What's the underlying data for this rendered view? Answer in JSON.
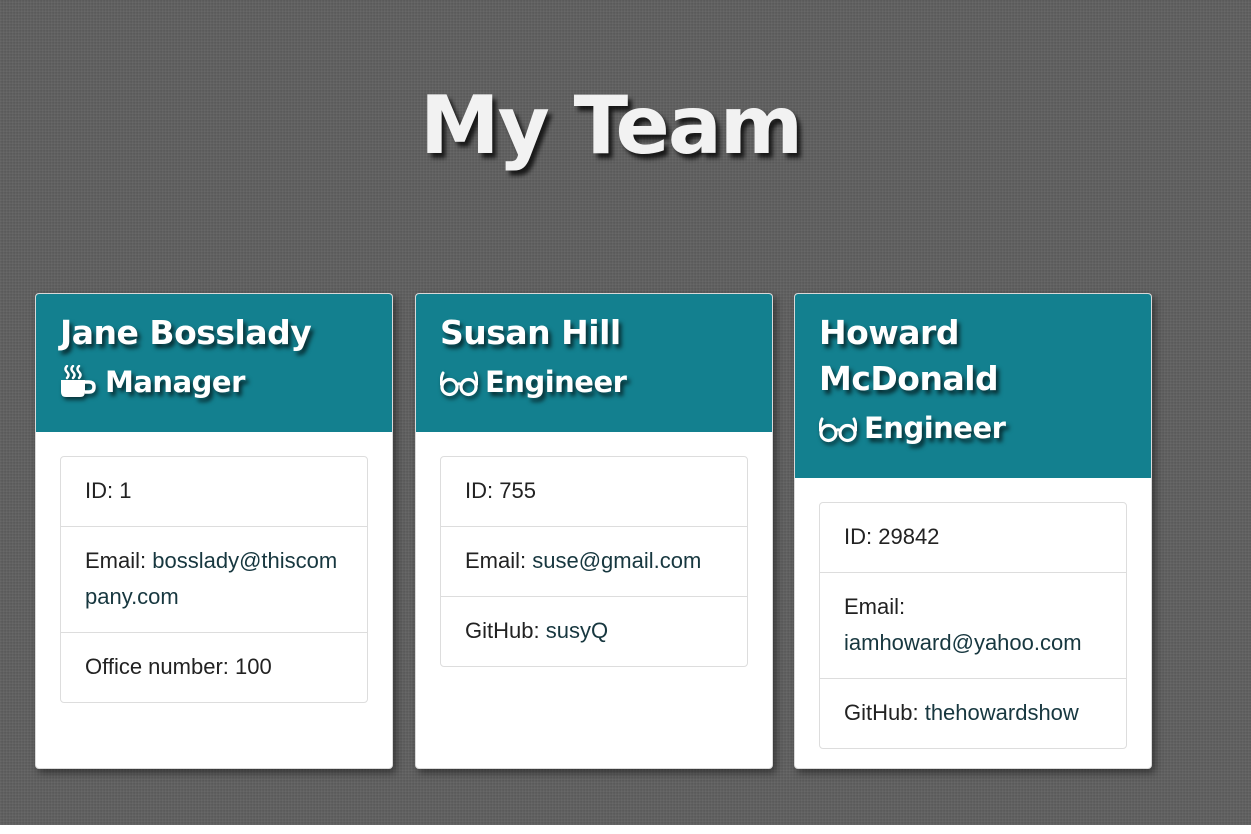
{
  "page": {
    "title": "My Team"
  },
  "team": [
    {
      "name": "Jane Bosslady",
      "role": "Manager",
      "role_icon": "coffee-mug-icon",
      "id_label": "ID: ",
      "id": "1",
      "email_label": "Email: ",
      "email": "bosslady@thiscompany.com",
      "extra_label": "Office number: ",
      "extra_value": "100"
    },
    {
      "name": "Susan Hill",
      "role": "Engineer",
      "role_icon": "glasses-icon",
      "id_label": "ID: ",
      "id": "755",
      "email_label": "Email: ",
      "email": "suse@gmail.com",
      "extra_label": "GitHub: ",
      "extra_value": "susyQ"
    },
    {
      "name": "Howard McDonald",
      "role": "Engineer",
      "role_icon": "glasses-icon",
      "id_label": "ID: ",
      "id": "29842",
      "email_label": "Email: ",
      "email": "iamhoward@yahoo.com",
      "extra_label": "GitHub: ",
      "extra_value": "thehowardshow"
    }
  ],
  "colors": {
    "card_header": "#13808f",
    "background": "#5e5e5e",
    "title_text": "#f2f2f2"
  }
}
